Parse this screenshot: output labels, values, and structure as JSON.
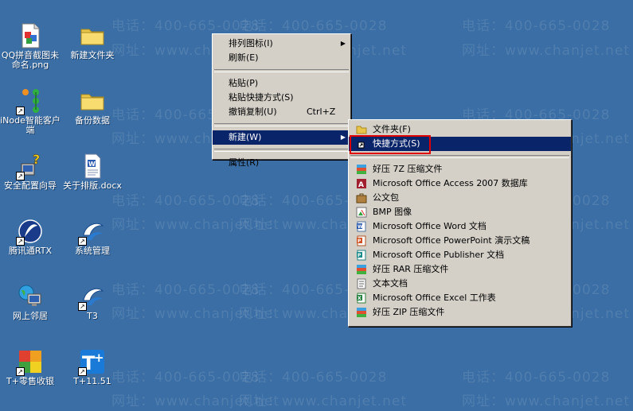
{
  "watermark": {
    "phone": "电话：400-665-0028",
    "site": "网址：www.chanjet.net"
  },
  "desktop_icons": [
    {
      "name": "QQ拼音截图未命名.png",
      "icon": "image-file-icon"
    },
    {
      "name": "新建文件夹",
      "icon": "folder-icon"
    },
    {
      "name": "iNode智能客户端",
      "icon": "inode-client-icon"
    },
    {
      "name": "备份数据",
      "icon": "folder-icon"
    },
    {
      "name": "安全配置向导",
      "icon": "security-wizard-icon"
    },
    {
      "name": "关于排版.docx",
      "icon": "word-document-icon"
    },
    {
      "name": "腾讯通RTX",
      "icon": "rtx-icon"
    },
    {
      "name": "系统管理",
      "icon": "system-admin-icon"
    },
    {
      "name": "网上邻居",
      "icon": "network-neighborhood-icon"
    },
    {
      "name": "T3",
      "icon": "t3-icon"
    },
    {
      "name": "T+零售收银",
      "icon": "retail-pos-icon"
    },
    {
      "name": "T+11.51",
      "icon": "tplus-icon"
    }
  ],
  "context_menu": {
    "arrange": "排列图标(I)",
    "refresh": "刷新(E)",
    "paste": "粘贴(P)",
    "paste_shortcut": "粘贴快捷方式(S)",
    "undo_copy": "撤销复制(U)",
    "undo_copy_shortcut": "Ctrl+Z",
    "new": "新建(W)",
    "properties": "属性(R)"
  },
  "new_submenu": {
    "folder": "文件夹(F)",
    "shortcut": "快捷方式(S)",
    "items": [
      {
        "label": "好压 7Z 压缩文件",
        "icon": "archive-7z-icon"
      },
      {
        "label": "Microsoft Office Access 2007 数据库",
        "icon": "access-icon"
      },
      {
        "label": "公文包",
        "icon": "briefcase-icon"
      },
      {
        "label": "BMP 图像",
        "icon": "bmp-image-icon"
      },
      {
        "label": "Microsoft Office Word 文档",
        "icon": "word-icon"
      },
      {
        "label": "Microsoft Office PowerPoint 演示文稿",
        "icon": "powerpoint-icon"
      },
      {
        "label": "Microsoft Office Publisher 文档",
        "icon": "publisher-icon"
      },
      {
        "label": "好压 RAR 压缩文件",
        "icon": "archive-rar-icon"
      },
      {
        "label": "文本文档",
        "icon": "text-document-icon"
      },
      {
        "label": "Microsoft Office Excel 工作表",
        "icon": "excel-icon"
      },
      {
        "label": "好压 ZIP 压缩文件",
        "icon": "archive-zip-icon"
      }
    ]
  },
  "colors": {
    "desktop": "#3a6ea5",
    "menu_bg": "#d4d0c8",
    "highlight": "#0a246a",
    "annotation": "#e00000"
  }
}
